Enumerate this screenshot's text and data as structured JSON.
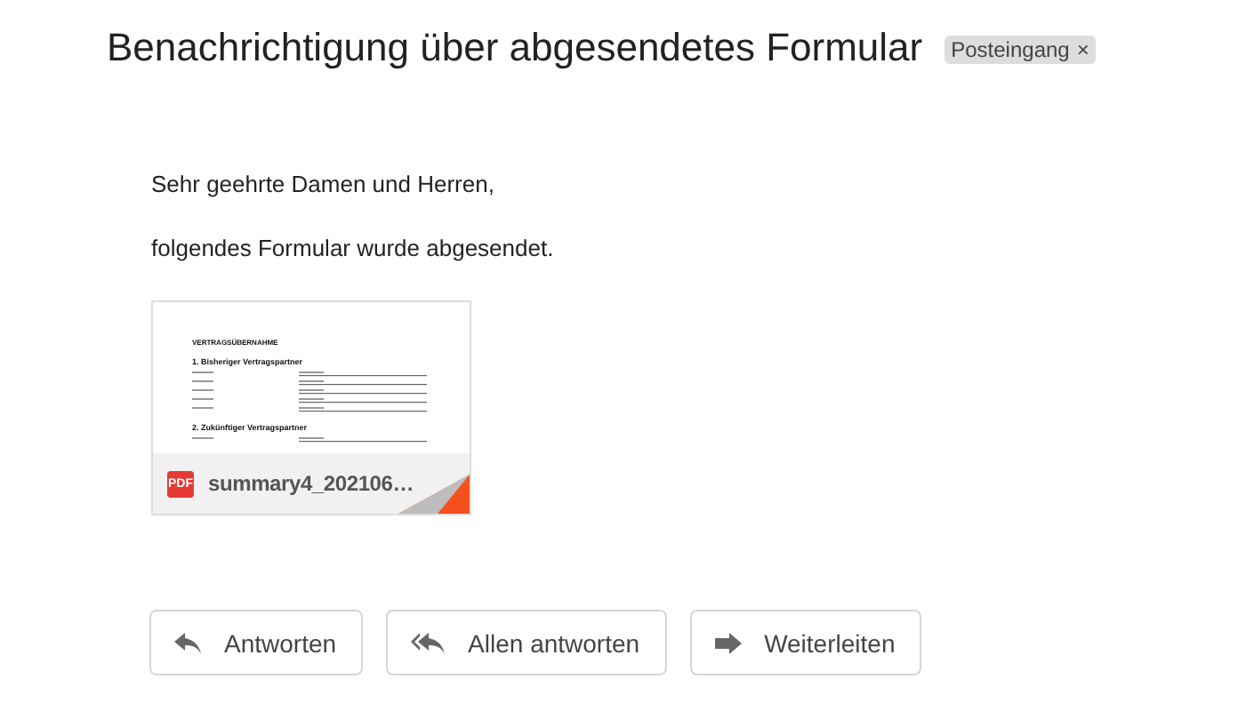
{
  "subject": "Benachrichtigung über abgesendetes Formular",
  "labels": [
    {
      "text": "Posteingang",
      "close": "×"
    }
  ],
  "body": [
    "Sehr geehrte Damen und Herren,",
    "folgendes Formular wurde abgesendet."
  ],
  "attachments": [
    {
      "type": "PDF",
      "filename": "summary4_202106…",
      "preview": {
        "title": "VERTRAGSÜBERNAHME",
        "sections": [
          "1. Bisheriger Vertragspartner",
          "2. Zukünftiger Vertragspartner"
        ]
      }
    }
  ],
  "actions": [
    {
      "kind": "reply",
      "label": "Antworten"
    },
    {
      "kind": "reply_all",
      "label": "Allen antworten"
    },
    {
      "kind": "forward",
      "label": "Weiterleiten"
    }
  ]
}
